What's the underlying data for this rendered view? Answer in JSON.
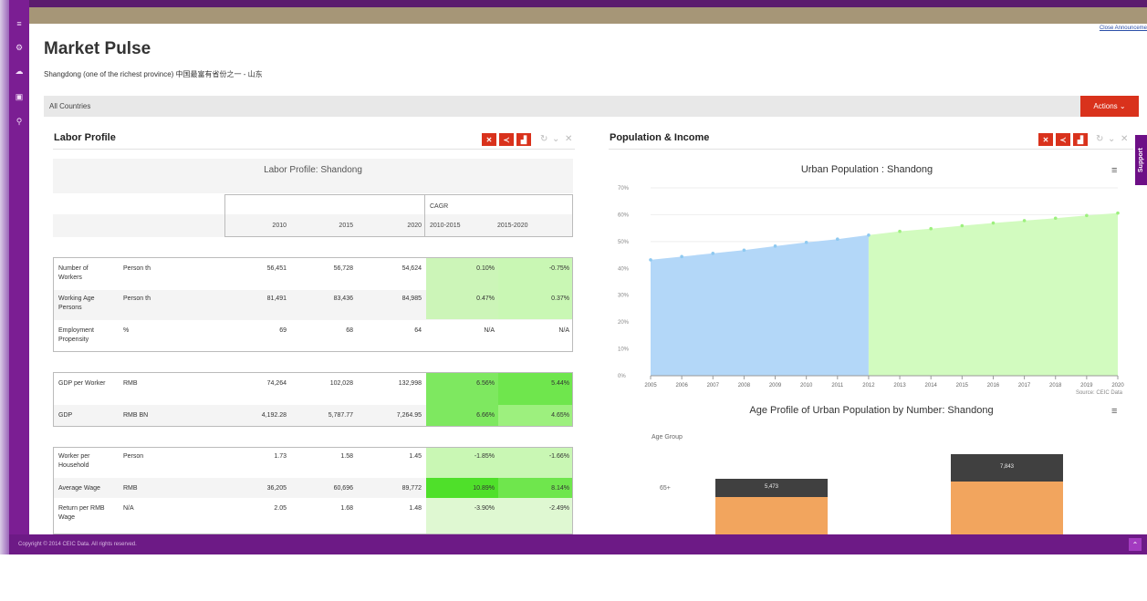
{
  "app": {
    "close_announcement": "Close Announceme",
    "footer": "Copyright © 2014 CEIC Data. All rights reserved.",
    "support": "Support",
    "sidebar_icons": [
      "menu-icon",
      "gear-icon",
      "cloud-icon",
      "briefcase-icon",
      "map-pin-icon"
    ]
  },
  "page": {
    "title": "Market Pulse",
    "subtitle": "Shangdong (one of the richest province) 中国最富有省份之一 - 山东"
  },
  "filter": {
    "label": "All Countries",
    "actions": "Actions ⌄"
  },
  "labor": {
    "panel_title": "Labor Profile",
    "table_title": "Labor Profile: Shandong",
    "cagr": "CAGR",
    "years": [
      "2010",
      "2015",
      "2020"
    ],
    "cagr_cols": [
      "2010-2015",
      "2015-2020"
    ],
    "groups": [
      [
        {
          "name": "Number of Workers",
          "unit": "Person th",
          "v": [
            "56,451",
            "56,728",
            "54,624"
          ],
          "c": [
            "0.10%",
            "-0.75%"
          ]
        },
        {
          "name": "Working Age Persons",
          "unit": "Person th",
          "v": [
            "81,491",
            "83,436",
            "84,985"
          ],
          "c": [
            "0.47%",
            "0.37%"
          ]
        },
        {
          "name": "Employment Propensity",
          "unit": "%",
          "v": [
            "69",
            "68",
            "64"
          ],
          "c": [
            "N/A",
            "N/A"
          ]
        }
      ],
      [
        {
          "name": "GDP per Worker",
          "unit": "RMB",
          "v": [
            "74,264",
            "102,028",
            "132,998"
          ],
          "c": [
            "6.56%",
            "5.44%"
          ]
        },
        {
          "name": "GDP",
          "unit": "RMB BN",
          "v": [
            "4,192.28",
            "5,787.77",
            "7,264.95"
          ],
          "c": [
            "6.66%",
            "4.65%"
          ]
        }
      ],
      [
        {
          "name": "Worker per Household",
          "unit": "Person",
          "v": [
            "1.73",
            "1.58",
            "1.45"
          ],
          "c": [
            "-1.85%",
            "-1.66%"
          ]
        },
        {
          "name": "Average Wage",
          "unit": "RMB",
          "v": [
            "36,205",
            "60,696",
            "89,772"
          ],
          "c": [
            "10.89%",
            "8.14%"
          ]
        },
        {
          "name": "Return per RMB Wage",
          "unit": "N/A",
          "v": [
            "2.05",
            "1.68",
            "1.48"
          ],
          "c": [
            "-3.90%",
            "-2.49%"
          ]
        }
      ]
    ],
    "colors": {
      "green1": "#ccf5b8",
      "green2": "#7ee860",
      "green3": "#c9f7b4",
      "green4": "#4fe02a",
      "green5": "#dff8d2",
      "green6": "#9df07e"
    }
  },
  "population": {
    "panel_title": "Population & Income",
    "source": "Source: CEIC Data",
    "age_axis_label": "Age Group",
    "age_category": "65+"
  },
  "chart_data": [
    {
      "type": "area",
      "title": "Urban Population : Shandong",
      "x": [
        "2005",
        "2006",
        "2007",
        "2008",
        "2009",
        "2010",
        "2011",
        "2012",
        "2013",
        "2014",
        "2015",
        "2016",
        "2017",
        "2018",
        "2019",
        "2020"
      ],
      "values": [
        43.2,
        44.4,
        45.6,
        46.8,
        48.3,
        49.7,
        50.9,
        52.4,
        53.8,
        54.8,
        55.9,
        56.9,
        57.8,
        58.7,
        59.7,
        60.6
      ],
      "yticks": [
        "0%",
        "10%",
        "20%",
        "30%",
        "40%",
        "50%",
        "60%",
        "70%"
      ],
      "ylim": [
        0,
        70
      ],
      "split_after": "2012",
      "colors": {
        "historic": "#b3d7f8",
        "forecast": "#d2fbbf",
        "line": "#8ec9f0",
        "forecast_line": "#9df07e"
      }
    },
    {
      "type": "bar",
      "title": "Age Profile of Urban Population by Number: Shandong",
      "categories": [
        "65+"
      ],
      "series": [
        {
          "values": [
            5473
          ],
          "label": "5,473",
          "color": "#404040"
        },
        {
          "values": [
            7843
          ],
          "label": "7,843",
          "color": "#404040"
        }
      ],
      "under_color": "#f2a55e"
    }
  ]
}
